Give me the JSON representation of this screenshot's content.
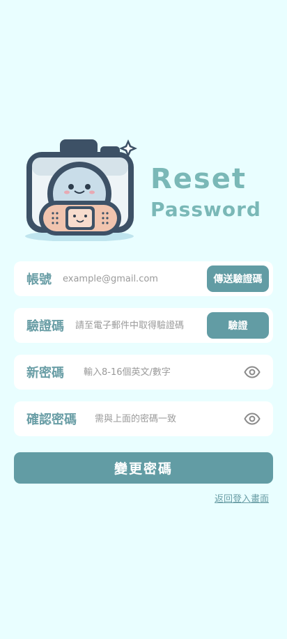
{
  "header": {
    "title_line1": "Reset",
    "title_line2": "Password",
    "logo_icon": "camera-bandage-mascot-icon"
  },
  "form": {
    "account": {
      "label": "帳號",
      "placeholder": "example@gmail.com",
      "button_label": "傳送驗證碼"
    },
    "code": {
      "label": "驗證碼",
      "placeholder": "請至電子郵件中取得驗證碼",
      "button_label": "驗證"
    },
    "new_password": {
      "label": "新密碼",
      "placeholder": "輸入8-16個英文/數字",
      "icon": "eye-icon"
    },
    "confirm_password": {
      "label": "確認密碼",
      "placeholder": "需與上面的密碼一致",
      "icon": "eye-icon"
    },
    "submit_label": "變更密碼",
    "back_link": "返回登入畫面"
  },
  "colors": {
    "background": "#e9feff",
    "accent": "#629ca4",
    "label": "#6a9ea6",
    "title": "#7ab8b7"
  }
}
